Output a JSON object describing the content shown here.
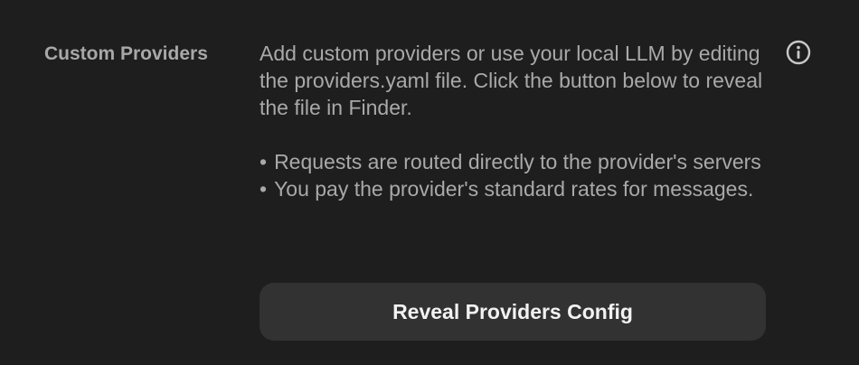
{
  "settings": {
    "label": "Custom Providers",
    "description": "Add custom providers or use your local LLM by editing the providers.yaml file. Click the button below to reveal the file in Finder.",
    "bullets": [
      "Requests are routed directly to the provider's servers",
      "You pay the provider's standard rates for messages."
    ],
    "bullet_glyph": "•",
    "button_label": "Reveal Providers Config",
    "info_icon": "info-circle"
  },
  "colors": {
    "background": "#1e1e1e",
    "label_text": "#a8a8a8",
    "body_text": "#a9a9a9",
    "button_background": "#323232",
    "button_text": "#f2f2f2",
    "icon": "#c8c8c8"
  }
}
